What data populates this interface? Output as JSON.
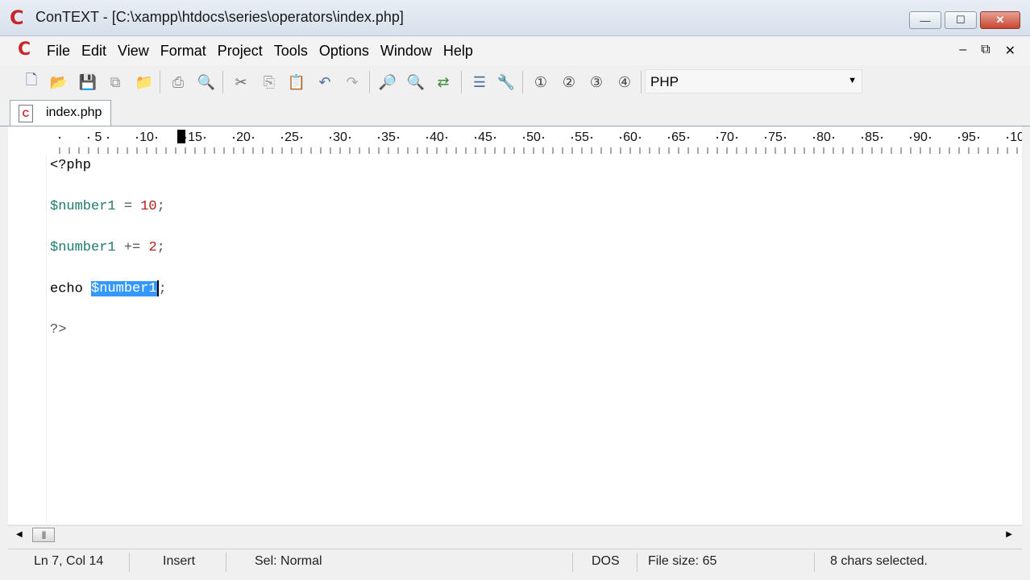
{
  "window": {
    "title": "ConTEXT - [C:\\xampp\\htdocs\\series\\operators\\index.php]",
    "icon": "context-app-icon",
    "buttons": {
      "minimize": "—",
      "maximize": "☐",
      "close": "✕"
    }
  },
  "menu": {
    "items": [
      "File",
      "Edit",
      "View",
      "Format",
      "Project",
      "Tools",
      "Options",
      "Window",
      "Help"
    ],
    "mdi": {
      "minimize": "–",
      "restore": "⧉",
      "close": "✕"
    }
  },
  "toolbar": {
    "icons": [
      {
        "name": "new-file-icon",
        "glyph": "🗋"
      },
      {
        "name": "open-file-icon",
        "glyph": "📂"
      },
      {
        "name": "save-icon",
        "glyph": "💾"
      },
      {
        "name": "save-all-icon",
        "glyph": "⧉"
      },
      {
        "name": "open-folder-icon",
        "glyph": "📁"
      },
      {
        "name": "print-icon",
        "glyph": "⎙"
      },
      {
        "name": "print-preview-icon",
        "glyph": "🔍"
      },
      {
        "name": "cut-icon",
        "glyph": "✂"
      },
      {
        "name": "copy-icon",
        "glyph": "⎘"
      },
      {
        "name": "paste-icon",
        "glyph": "📋"
      },
      {
        "name": "undo-icon",
        "glyph": "↶"
      },
      {
        "name": "redo-icon",
        "glyph": "↷"
      },
      {
        "name": "find-icon",
        "glyph": "🔎"
      },
      {
        "name": "find-next-icon",
        "glyph": "🔍"
      },
      {
        "name": "replace-icon",
        "glyph": "⇄"
      },
      {
        "name": "file-compare-icon",
        "glyph": "☰"
      },
      {
        "name": "settings-wrench-icon",
        "glyph": "🔧"
      },
      {
        "name": "user-command-1-icon",
        "glyph": "①"
      },
      {
        "name": "user-command-2-icon",
        "glyph": "②"
      },
      {
        "name": "user-command-3-icon",
        "glyph": "③"
      },
      {
        "name": "user-command-4-icon",
        "glyph": "④"
      }
    ],
    "highlighter_value": "PHP"
  },
  "tabs": [
    {
      "label": "index.php"
    }
  ],
  "ruler": {
    "labels": [
      "5",
      "10",
      "15",
      "20",
      "25",
      "30",
      "35",
      "40",
      "45",
      "50",
      "55",
      "60",
      "65",
      "70",
      "75",
      "80",
      "85",
      "90",
      "95",
      "10"
    ]
  },
  "editor": {
    "lines": {
      "l1": "<?php",
      "l3_var": "$number1",
      "l3_op": " = ",
      "l3_num": "10",
      "l3_end": ";",
      "l5_var": "$number1",
      "l5_op": " += ",
      "l5_num": "2",
      "l5_end": ";",
      "l7_kw": "echo ",
      "l7_sel": "$number1",
      "l7_end": ";",
      "l9": "?>"
    }
  },
  "status": {
    "position": "Ln 7, Col 14",
    "mode": "Insert",
    "selection_mode": "Sel: Normal",
    "line_endings": "DOS",
    "file_size": "File size: 65",
    "selected": "8 chars selected."
  }
}
